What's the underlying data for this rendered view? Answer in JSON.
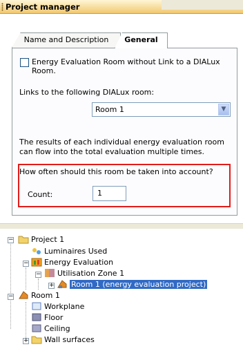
{
  "window": {
    "title": "Project manager"
  },
  "tabs": [
    {
      "label": "Name and Description",
      "active": false
    },
    {
      "label": "General",
      "active": true
    }
  ],
  "general": {
    "checkbox_label": "Energy Evaluation Room without Link to a DIALux Room.",
    "checkbox_checked": false,
    "links_label": "Links to the following DIALux room:",
    "room_select_value": "Room 1",
    "results_text": "The results of each individual energy evaluation room can flow into the total evaluation multiple times.",
    "how_often_label": "How often should this room be taken into account?",
    "count_label": "Count:",
    "count_value": "1"
  },
  "tree": {
    "project": "Project 1",
    "luminaires": "Luminaires Used",
    "energy_eval": "Energy Evaluation",
    "utilisation_zone": "Utilisation Zone 1",
    "selected_room": "Room 1 (energy evaluation project)",
    "room": "Room 1",
    "workplane": "Workplane",
    "floor": "Floor",
    "ceiling": "Ceiling",
    "wall_surfaces": "Wall surfaces"
  },
  "colors": {
    "highlight_red": "#e21b1b",
    "selection_blue": "#316ac5"
  }
}
